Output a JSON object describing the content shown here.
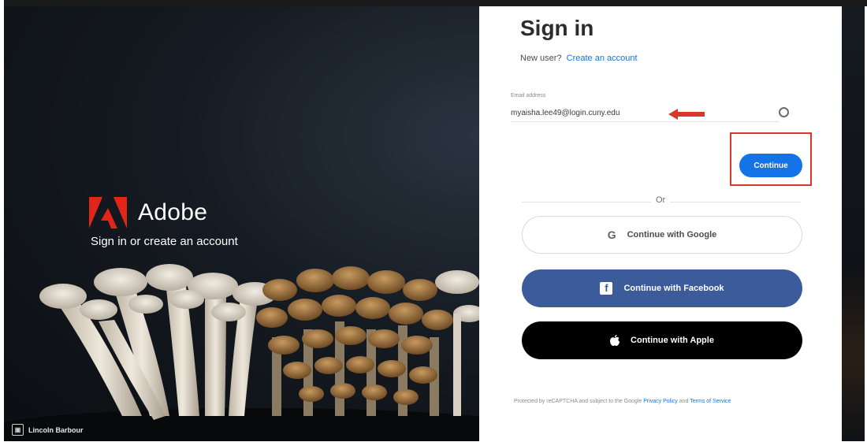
{
  "background": {
    "brand_name": "Adobe",
    "tagline": "Sign in or create an account",
    "photo_credit": "Lincoln Barbour"
  },
  "signin": {
    "title": "Sign in",
    "new_user_text": "New user?",
    "create_account_link": "Create an account",
    "email_label": "Email address",
    "email_value": "myaisha.lee49@login.cuny.edu",
    "continue_label": "Continue",
    "or_text": "Or",
    "google_label": "Continue with Google",
    "facebook_label": "Continue with Facebook",
    "apple_label": "Continue with Apple",
    "legal_text": "Protected by reCAPTCHA and subject to the Google",
    "privacy_link": "Privacy Policy",
    "and_text": "and",
    "terms_link": "Terms of Service"
  },
  "colors": {
    "accent": "#1473e6",
    "facebook": "#3b5b9a",
    "apple": "#000000",
    "adobe_red": "#e1251b",
    "highlight_box": "#d9372b"
  },
  "icons": {
    "brand": "adobe-logo-icon",
    "email_field": "account-circle-icon",
    "google": "google-g-icon",
    "facebook": "facebook-f-icon",
    "apple": "apple-icon",
    "annotation": "red-arrow-icon",
    "credit": "camera-icon"
  }
}
